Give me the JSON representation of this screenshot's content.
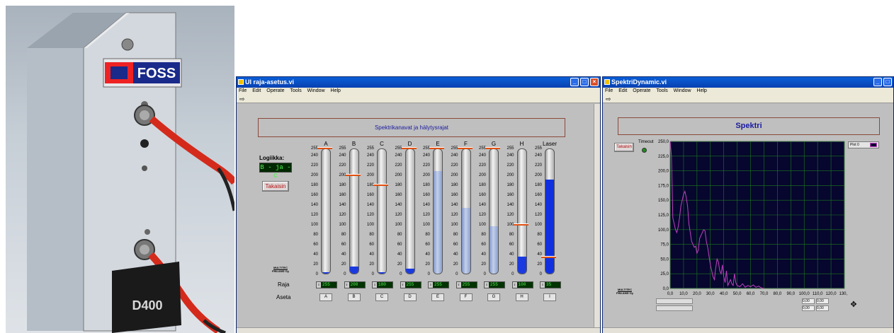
{
  "photo": {
    "brand": "FOSS",
    "model": "D400",
    "colors": {
      "cable": "#d42a1c",
      "panel": "#c8ced6",
      "badge": "#1a2a8a"
    }
  },
  "win1": {
    "title": "UI raja-asetus.vi",
    "menu": [
      "File",
      "Edit",
      "Operate",
      "Tools",
      "Window",
      "Help"
    ],
    "heading": "Spektrikanavat ja hälytysrajat",
    "logic_label": "Logiikka:",
    "logic_value": "B - ja - C",
    "back_button": "Takaisin",
    "company": [
      "MULTITEC",
      "FINLAND Oy"
    ],
    "raja_label": "Raja",
    "aseta_label": "Aseta",
    "scale_ticks": [
      "255",
      "240",
      "220",
      "200",
      "180",
      "160",
      "140",
      "120",
      "100",
      "80",
      "60",
      "40",
      "20",
      "0"
    ],
    "channels": [
      {
        "name": "A",
        "level": 3,
        "limit": 255,
        "raja": "255",
        "button": "A"
      },
      {
        "name": "B",
        "level": 15,
        "limit": 200,
        "raja": "200",
        "button": "B"
      },
      {
        "name": "C",
        "level": 3,
        "limit": 180,
        "raja": "180",
        "button": "C"
      },
      {
        "name": "D",
        "level": 10,
        "limit": 255,
        "raja": "255",
        "button": "D"
      },
      {
        "name": "E",
        "level": 210,
        "limit": 255,
        "raja": "255",
        "button": "E"
      },
      {
        "name": "F",
        "level": 135,
        "limit": 255,
        "raja": "255",
        "button": "F"
      },
      {
        "name": "G",
        "level": 97,
        "limit": 255,
        "raja": "255",
        "button": "G"
      },
      {
        "name": "H",
        "level": 35,
        "limit": 100,
        "raja": "100",
        "button": "H"
      },
      {
        "name": "Laser",
        "level": 193,
        "limit": 35,
        "raja": "35",
        "button": "I"
      }
    ]
  },
  "win2": {
    "title": "SpektriDynamic.vi",
    "menu": [
      "File",
      "Edit",
      "Operate",
      "Tools",
      "Window",
      "Help"
    ],
    "heading": "Spektri",
    "back_button": "Takaisin",
    "timeout_label": "Timeout",
    "plot_legend": "Plot 0",
    "company": [
      "MULTITEC",
      "FINLAND Oy"
    ],
    "small_values": [
      "0,00",
      "0,00",
      "0,00",
      "0,00"
    ],
    "chart_data": {
      "type": "line",
      "title": "",
      "xlabel": "",
      "ylabel": "",
      "xlim": [
        0,
        130
      ],
      "ylim": [
        0,
        250
      ],
      "x_ticks": [
        "0,0",
        "10,0",
        "20,0",
        "30,0",
        "40,0",
        "50,0",
        "60,0",
        "70,0",
        "80,0",
        "90,0",
        "100,0",
        "110,0",
        "120,0",
        "130,0"
      ],
      "y_ticks": [
        "250,0",
        "225,0",
        "200,0",
        "175,0",
        "150,0",
        "125,0",
        "100,0",
        "75,0",
        "50,0",
        "25,0",
        "0,0"
      ],
      "grid": true,
      "series": [
        {
          "name": "Plot 0",
          "x": [
            0,
            1,
            2,
            3,
            4,
            5,
            6,
            7,
            8,
            9,
            10,
            11,
            12,
            13,
            14,
            15,
            16,
            17,
            18,
            19,
            20,
            21,
            22,
            23,
            24,
            25,
            26,
            27,
            28,
            29,
            30,
            31,
            32,
            33,
            34,
            35,
            36,
            37,
            38,
            39,
            40,
            41,
            42,
            43,
            44,
            45,
            46,
            47,
            48,
            49,
            50,
            52,
            54,
            56,
            58,
            60,
            62,
            64,
            66,
            68,
            70
          ],
          "y": [
            250,
            225,
            120,
            110,
            100,
            95,
            105,
            120,
            140,
            150,
            160,
            165,
            155,
            140,
            110,
            95,
            80,
            75,
            70,
            72,
            60,
            65,
            85,
            90,
            95,
            100,
            98,
            80,
            70,
            55,
            40,
            30,
            20,
            15,
            35,
            50,
            45,
            30,
            25,
            40,
            20,
            10,
            30,
            5,
            10,
            15,
            8,
            5,
            25,
            10,
            5,
            3,
            8,
            2,
            5,
            3,
            6,
            2,
            4,
            1,
            0
          ]
        }
      ],
      "colors": {
        "background": "#06062e",
        "grid": "#1c7a1c",
        "line": "#c040c0"
      }
    }
  }
}
